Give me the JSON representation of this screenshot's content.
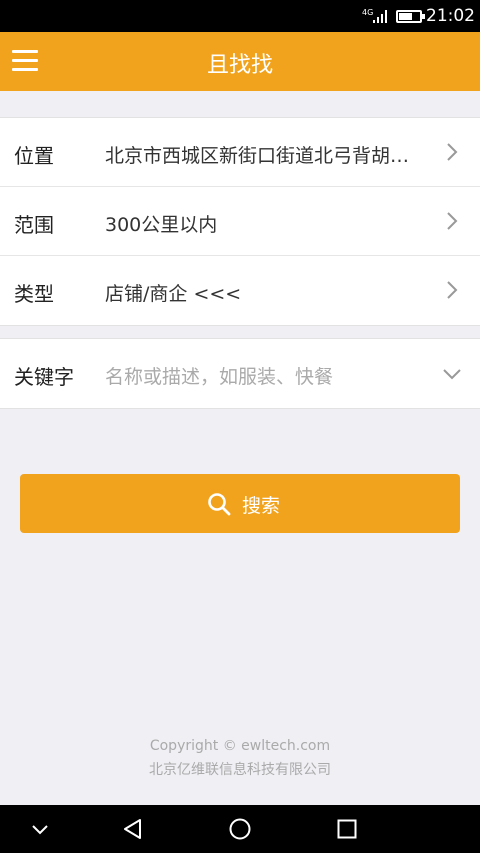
{
  "status_bar": {
    "network": "4G",
    "time": "21:02"
  },
  "app_bar": {
    "title": "且找找"
  },
  "form": {
    "location_label": "位置",
    "location_value": "北京市西城区新街口街道北弓背胡…",
    "range_label": "范围",
    "range_value": "300公里以内",
    "type_label": "类型",
    "type_value": "店铺/商企 <<<",
    "keyword_label": "关键字",
    "keyword_placeholder": "名称或描述，如服装、快餐"
  },
  "search_button": {
    "label": "搜索"
  },
  "footer": {
    "copyright": "Copyright © ewltech.com",
    "company": "北京亿维联信息科技有限公司"
  },
  "icons": {
    "menu": "menu-icon",
    "chevron_right": "chevron-right-icon",
    "chevron_down": "chevron-down-icon",
    "search": "search-icon",
    "back": "back-icon",
    "home": "home-icon",
    "recents": "recents-icon"
  },
  "colors": {
    "accent": "#f2a31d",
    "background": "#efeff4"
  }
}
